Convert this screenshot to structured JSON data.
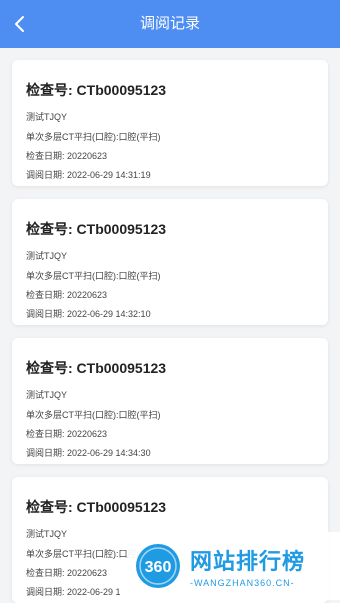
{
  "header": {
    "title": "调阅记录",
    "back_icon": "chevron-left-icon",
    "color": "#4e8df2"
  },
  "records": [
    {
      "exam_no": "检查号: CTb00095123",
      "patient": "测试TJQY",
      "item": "单次多层CT平扫(口腔):口腔(平扫)",
      "exam_date": "检查日期: 20220623",
      "access_time": "调阅日期: 2022-06-29 14:31:19"
    },
    {
      "exam_no": "检查号: CTb00095123",
      "patient": "测试TJQY",
      "item": "单次多层CT平扫(口腔):口腔(平扫)",
      "exam_date": "检查日期: 20220623",
      "access_time": "调阅日期: 2022-06-29 14:32:10"
    },
    {
      "exam_no": "检查号: CTb00095123",
      "patient": "测试TJQY",
      "item": "单次多层CT平扫(口腔):口腔(平扫)",
      "exam_date": "检查日期: 20220623",
      "access_time": "调阅日期: 2022-06-29 14:34:30"
    },
    {
      "exam_no": "检查号: CTb00095123",
      "patient": "测试TJQY",
      "item": "单次多层CT平扫(口腔):口腔(平扫)",
      "exam_date": "检查日期: 20220623",
      "access_time": "调阅日期: 2022-06-29 1"
    }
  ],
  "watermark": {
    "logo_text": "360",
    "title": "网站排行榜",
    "subtitle": "-WANGZHAN360.CN-",
    "color": "#1f9be3"
  }
}
